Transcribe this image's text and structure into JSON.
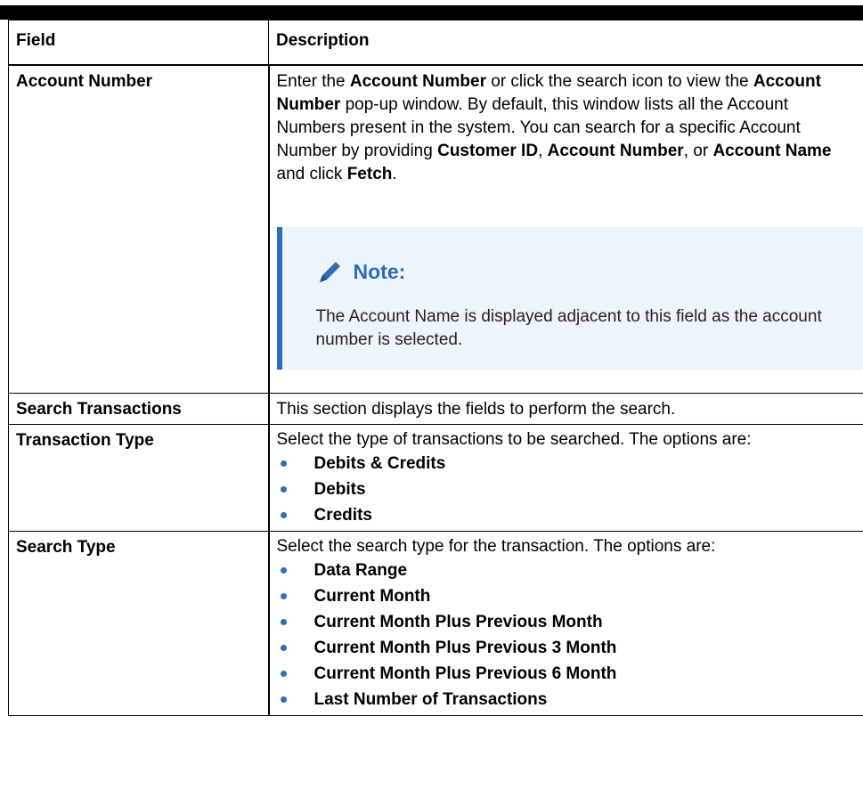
{
  "table": {
    "headers": {
      "field": "Field",
      "description": "Description"
    },
    "rows": {
      "account_number": {
        "field": "Account Number",
        "desc": [
          "Enter the ",
          "Account Number",
          " or click the search icon to view the ",
          "Account Number",
          " pop-up window. By default, this window lists all the Account Numbers present in the system. You can search for a specific Account Number by providing ",
          "Customer ID",
          ", ",
          "Account Number",
          ", or ",
          "Account Name",
          " and click ",
          "Fetch",
          "."
        ],
        "note": {
          "title": "Note:",
          "icon": "pencil-icon",
          "body": "The Account Name is displayed adjacent to this field as the account number is selected."
        }
      },
      "search_transactions": {
        "field": "Search Transactions",
        "desc": "This section displays the fields to perform the search."
      },
      "transaction_type": {
        "field": "Transaction Type",
        "desc": "Select the type of transactions to be searched. The options are:",
        "options": [
          "Debits & Credits",
          "Debits",
          "Credits"
        ]
      },
      "search_type": {
        "field": "Search Type",
        "desc": "Select the search type for the transaction. The options are:",
        "options": [
          "Data Range",
          "Current Month",
          "Current Month Plus Previous Month",
          "Current Month Plus Previous 3 Month",
          "Current Month Plus Previous 6 Month",
          "Last Number of Transactions"
        ]
      }
    }
  },
  "colors": {
    "accent": "#2f6db5",
    "note_bg": "#eef4fb",
    "rule": "#000000"
  }
}
